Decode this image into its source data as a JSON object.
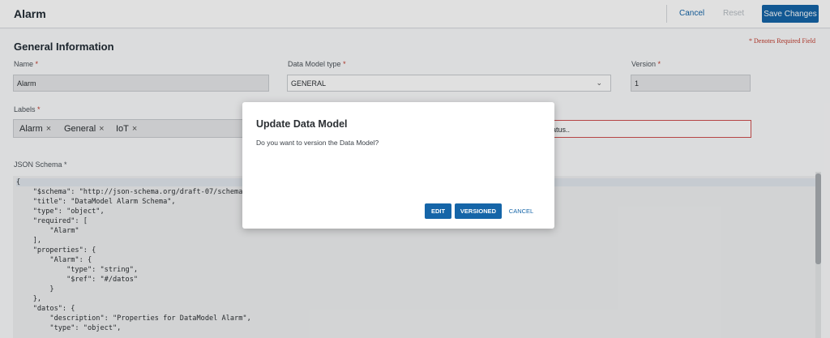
{
  "header": {
    "title": "Alarm",
    "cancel_label": "Cancel",
    "reset_label": "Reset",
    "save_label": "Save Changes"
  },
  "form": {
    "section_title": "General Information",
    "required_note": "* Denotes Required Field",
    "name": {
      "label": "Name",
      "value": "Alarm"
    },
    "data_model_type": {
      "label": "Data Model type",
      "value": "GENERAL"
    },
    "version": {
      "label": "Version",
      "value": "1"
    },
    "labels": {
      "label": "Labels",
      "tags": [
        "Alarm",
        "General",
        "IoT"
      ]
    },
    "status_field_value": "atus..",
    "json_schema_label": "JSON Schema",
    "required_star": "*"
  },
  "code_lines": [
    "{",
    "    \"$schema\": \"http://json-schema.org/draft-07/schema#\",",
    "    \"title\": \"DataModel Alarm Schema\",",
    "    \"type\": \"object\",",
    "    \"required\": [",
    "        \"Alarm\"",
    "    ],",
    "    \"properties\": {",
    "        \"Alarm\": {",
    "            \"type\": \"string\",",
    "            \"$ref\": \"#/datos\"",
    "        }",
    "    },",
    "    \"datos\": {",
    "        \"description\": \"Properties for DataModel Alarm\",",
    "        \"type\": \"object\","
  ],
  "modal": {
    "title": "Update Data Model",
    "message": "Do you want to version the Data Model?",
    "edit_label": "EDIT",
    "versioned_label": "VERSIONED",
    "cancel_label": "CANCEL"
  },
  "icons": {
    "remove_tag": "×",
    "chevron": "⌄"
  },
  "colors": {
    "accent": "#1565a8",
    "required": "#c0392b"
  }
}
